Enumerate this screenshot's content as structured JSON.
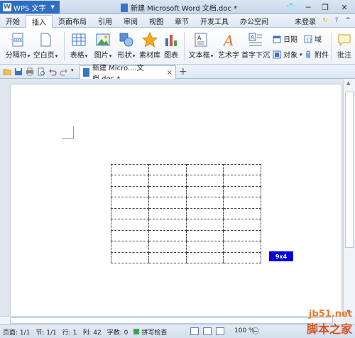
{
  "titlebar": {
    "app_menu": "WPS 文字",
    "doc_title": "新建 Microsoft Word 文档.doc *"
  },
  "menu": {
    "tabs": [
      "开始",
      "插入",
      "页面布局",
      "引用",
      "审阅",
      "视图",
      "章节",
      "开发工具",
      "办公空间"
    ],
    "login": "未登录"
  },
  "ribbon": {
    "page_break": "分隔符",
    "blank_page": "空白页",
    "table": "表格",
    "picture": "图片",
    "shapes": "形状",
    "material": "素材库",
    "chart": "图表",
    "textbox": "文本框",
    "art_text": "艺术字",
    "drop_cap": "首字下沉",
    "date": "日期",
    "field": "域",
    "object": "对象",
    "attachment": "附件",
    "comment": "批注"
  },
  "quickbar": {
    "doc_tab": "新建 Micro....文档.doc *",
    "add_tab": "+"
  },
  "document": {
    "table_rows": 9,
    "table_cols": 4,
    "size_badge": "9x4"
  },
  "status": {
    "page": "页面: 1/1",
    "section": "节: 1/1",
    "row": "行: 1",
    "col": "列: 42",
    "words": "字数: 0",
    "spell": "拼写检查",
    "zoom": "100 %"
  },
  "watermark": {
    "url": "jb51.net",
    "cn": "脚本之家"
  },
  "colors": {
    "accent": "#2f6fc3",
    "badge": "#0000dd"
  }
}
